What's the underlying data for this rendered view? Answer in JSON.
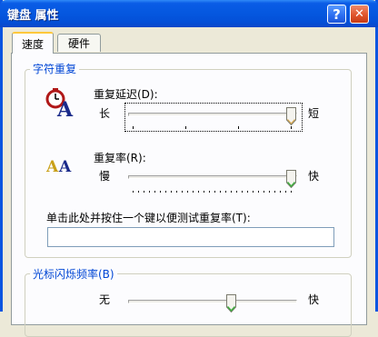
{
  "window": {
    "title": "键盘 属性",
    "help_glyph": "?",
    "close_glyph": "✕"
  },
  "tabs": [
    {
      "label": "速度",
      "active": true
    },
    {
      "label": "硬件",
      "active": false
    }
  ],
  "char_repeat": {
    "group_title": "字符重复",
    "delay": {
      "label": "重复延迟(D):",
      "min_label": "长",
      "max_label": "短",
      "value_fraction": 1.0,
      "icon": "clock-a-icon"
    },
    "rate": {
      "label": "重复率(R):",
      "min_label": "慢",
      "max_label": "快",
      "value_fraction": 1.0,
      "icon": "aa-icon"
    },
    "test_label": "单击此处并按住一个键以便测试重复率(T):",
    "test_value": ""
  },
  "cursor_blink": {
    "group_title": "光标闪烁频率(B)",
    "min_label": "无",
    "max_label": "快",
    "value_fraction": 0.62
  },
  "colors": {
    "group_title": "#0046d5",
    "accent_tab": "#ffc83c"
  }
}
